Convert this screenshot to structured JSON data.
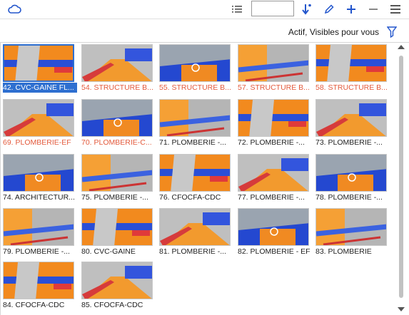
{
  "toolbar": {
    "cloud_icon": "cloud-icon",
    "list_icon": "list-icon",
    "input_value": "",
    "sort_icon": "sort-down-icon",
    "edit_icon": "pencil-icon",
    "add_icon": "plus-icon",
    "remove_icon": "minus-icon",
    "menu_icon": "hamburger-menu-icon",
    "accent": "#2255cc"
  },
  "filter": {
    "label": "Actif, Visibles pour vous",
    "icon": "filter-funnel-icon"
  },
  "colors": {
    "selected": "#2e6fd0",
    "red_caption": "#e35a3c",
    "normal_caption": "#1f1f1f"
  },
  "views": [
    {
      "label": "42. CVC-GAINE FL...",
      "color": "selected",
      "selected": true
    },
    {
      "label": "54. STRUCTURE B...",
      "color": "red"
    },
    {
      "label": "55. STRUCTURE B...",
      "color": "red"
    },
    {
      "label": "57. STRUCTURE B...",
      "color": "red"
    },
    {
      "label": "58. STRUCTURE B...",
      "color": "red"
    },
    {
      "label": "69. PLOMBERIE-EF",
      "color": "red"
    },
    {
      "label": "70. PLOMBERIE-C...",
      "color": "red"
    },
    {
      "label": "71. PLOMBERIE -...",
      "color": "normal"
    },
    {
      "label": "72. PLOMBERIE -...",
      "color": "normal"
    },
    {
      "label": "73. PLOMBERIE -...",
      "color": "normal"
    },
    {
      "label": "74. ARCHITECTUR...",
      "color": "normal"
    },
    {
      "label": "75. PLOMBERIE -...",
      "color": "normal"
    },
    {
      "label": "76. CFOCFA-CDC",
      "color": "normal"
    },
    {
      "label": "77. PLOMBERIE -...",
      "color": "normal"
    },
    {
      "label": "78. PLOMBERIE -...",
      "color": "normal"
    },
    {
      "label": "79. PLOMBERIE -...",
      "color": "normal"
    },
    {
      "label": "80. CVC-GAINE",
      "color": "normal"
    },
    {
      "label": "81. PLOMBERIE -...",
      "color": "normal"
    },
    {
      "label": "82. PLOMBERIE - EF",
      "color": "normal"
    },
    {
      "label": "83. PLOMBERIE",
      "color": "normal"
    },
    {
      "label": "84. CFOCFA-CDC",
      "color": "normal"
    },
    {
      "label": "85. CFOCFA-CDC",
      "color": "normal"
    }
  ]
}
